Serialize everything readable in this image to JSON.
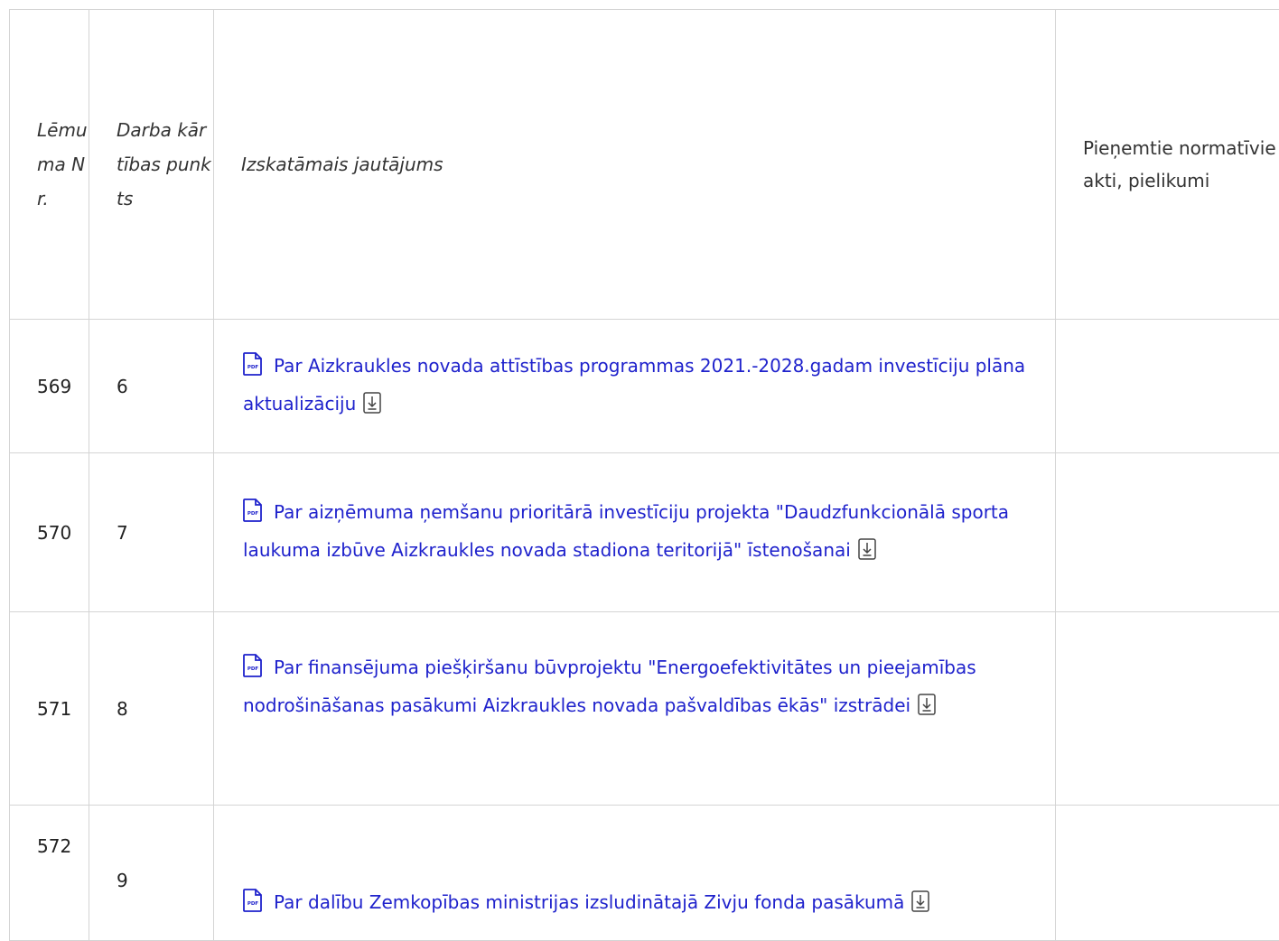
{
  "table": {
    "headers": {
      "decision_no": "Lēmuma Nr.",
      "agenda_item": "Darba kārtības punkts",
      "issue": "Izskatāmais jautājums",
      "acts": "Pieņemtie normatīvie akti, pielikumi"
    },
    "rows": [
      {
        "decision_no": "569",
        "agenda_item": "6",
        "issue": "Par Aizkraukles novada attīstības programmas 2021.-2028.gadam investīciju plāna aktualizāciju",
        "acts": ""
      },
      {
        "decision_no": "570",
        "agenda_item": "7",
        "issue": "Par aizņēmuma ņemšanu prioritārā investīciju projekta \"Daudzfunkcionālā sporta laukuma izbūve Aizkraukles novada stadiona teritorijā\" īstenošanai",
        "acts": ""
      },
      {
        "decision_no": "571",
        "agenda_item": "8",
        "issue": "Par finansējuma piešķiršanu būvprojektu \"Energoefektivitātes un pieejamības nodrošināšanas pasākumi Aizkraukles novada pašvaldības ēkās\" izstrādei",
        "acts": ""
      },
      {
        "decision_no": "572",
        "agenda_item": "9",
        "issue": "Par dalību Zemkopības ministrijas izsludinātajā Zivju fonda pasākumā",
        "acts": ""
      }
    ]
  },
  "icons": {
    "pdf": "pdf-file-icon",
    "download": "download-icon"
  },
  "colors": {
    "link": "#1f22cc",
    "border": "#d4d4d4"
  }
}
